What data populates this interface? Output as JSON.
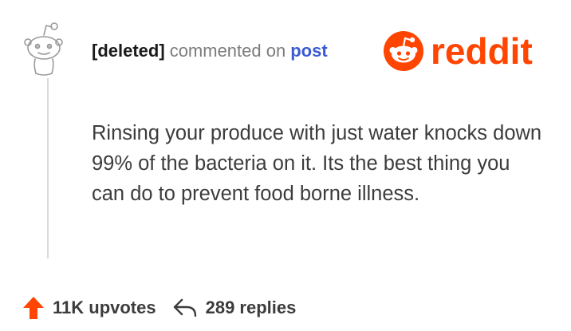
{
  "comment": {
    "author": "[deleted]",
    "action_text": "commented on",
    "target_link": "post",
    "body": "Rinsing your produce with just water knocks down 99% of the bacteria on it.  Its the best thing you can do to prevent food borne illness."
  },
  "brand": {
    "name": "reddit",
    "color": "#ff4500"
  },
  "footer": {
    "upvotes_label": "11K upvotes",
    "replies_label": "289 replies"
  },
  "icons": {
    "avatar": "deleted-user-snoo-icon",
    "logo": "reddit-snoo-icon",
    "upvote": "upvote-arrow-icon",
    "reply": "reply-arrow-icon"
  }
}
